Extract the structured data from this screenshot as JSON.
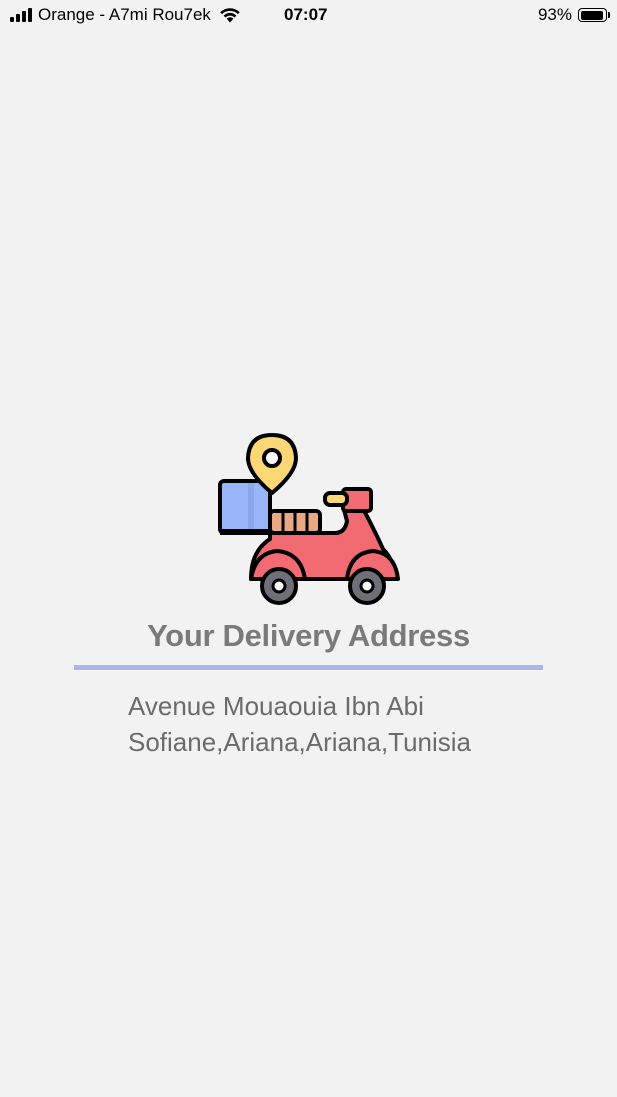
{
  "status_bar": {
    "carrier": "Orange - A7mi Rou7ek",
    "time": "07:07",
    "battery_percent": "93%",
    "battery_level": 0.93,
    "signal_bars": 4,
    "wifi_icon": "wifi-icon"
  },
  "illustration": {
    "icon": "delivery-scooter-icon",
    "colors": {
      "scooter_body": "#f26b73",
      "box": "#98b6f5",
      "pin": "#fcd875",
      "seat": "#e8a882",
      "wheel": "#6f6f78",
      "outline": "#000000"
    }
  },
  "main": {
    "title": "Your Delivery Address",
    "address": "Avenue Mouaouia Ibn Abi Sofiane,Ariana,Ariana,Tunisia",
    "divider_color": "#a7b6eb"
  }
}
